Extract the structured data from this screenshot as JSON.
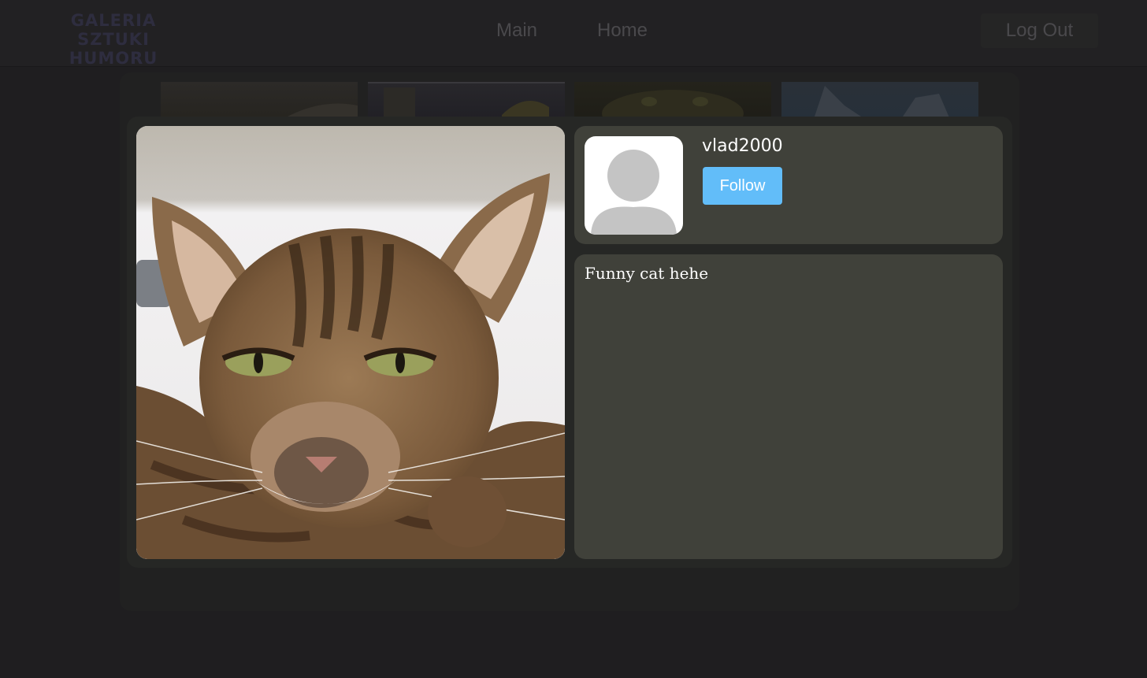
{
  "header": {
    "logo_line1": "GALERIA",
    "logo_line2": "SZTUKI HUMORU",
    "nav": {
      "main_label": "Main",
      "home_label": "Home"
    },
    "logout_label": "Log Out"
  },
  "post": {
    "image_icon": "cat-photo",
    "avatar_icon": "default-user-avatar-icon",
    "username": "vlad2000",
    "follow_label": "Follow",
    "description": "Funny cat hehe"
  },
  "colors": {
    "background": "#1f1e20",
    "card": "#40413a",
    "accent": "#62bdf9",
    "text": "#ffffff"
  }
}
